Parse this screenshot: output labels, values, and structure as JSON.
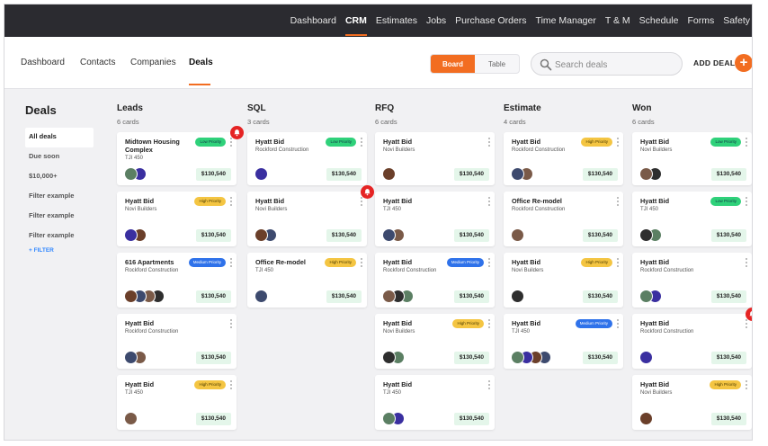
{
  "topnav": [
    "Dashboard",
    "CRM",
    "Estimates",
    "Jobs",
    "Purchase Orders",
    "Time Manager",
    "T & M",
    "Schedule",
    "Forms",
    "Safety"
  ],
  "topnav_active": "CRM",
  "subnav": [
    "Dashboard",
    "Contacts",
    "Companies",
    "Deals"
  ],
  "subnav_active": "Deals",
  "view_toggle": {
    "board": "Board",
    "table": "Table",
    "selected": "Board"
  },
  "search": {
    "placeholder": "Search deals",
    "value": ""
  },
  "add_deal": "ADD DEAL",
  "sidebar": {
    "title": "Deals",
    "items": [
      "All deals",
      "Due soon",
      "$10,000+",
      "Filter example",
      "Filter example",
      "Filter example"
    ],
    "active_index": 0,
    "filter_link": "+ FILTER"
  },
  "priority_labels": {
    "low": "Low Priority",
    "high": "High Priority",
    "medium": "Medium Priority"
  },
  "colors": {
    "accent": "#f26d21",
    "topbar": "#2b2b30",
    "low": "#2fd17a",
    "high": "#f4c542",
    "medium": "#2f72ea",
    "alert": "#e52424",
    "amount_bg": "#e4f6ea",
    "link": "#2f86ff"
  },
  "avatar_colors": [
    "#5b7f63",
    "#3a2fa0",
    "#6b3f2a",
    "#3d4a6e",
    "#7a5a48",
    "#2e2e2e"
  ],
  "columns": [
    {
      "title": "Leads",
      "count": "6 cards",
      "cards": [
        {
          "title": "Midtown Housing Complex",
          "sub": "TJI 450",
          "priority": "low",
          "amount": "$130,540",
          "avatars": 2,
          "alert": true
        },
        {
          "title": "Hyatt Bid",
          "sub": "Novi Builders",
          "priority": "high",
          "amount": "$130,540",
          "avatars": 2
        },
        {
          "title": "616 Apartments",
          "sub": "Rockford Construction",
          "priority": "medium",
          "amount": "$130,540",
          "avatars": 4
        },
        {
          "title": "Hyatt Bid",
          "sub": "Rockford Construction",
          "priority": null,
          "amount": "$130,540",
          "avatars": 2
        },
        {
          "title": "Hyatt Bid",
          "sub": "TJI 450",
          "priority": "high",
          "amount": "$130,540",
          "avatars": 1
        }
      ]
    },
    {
      "title": "SQL",
      "count": "3 cards",
      "cards": [
        {
          "title": "Hyatt Bid",
          "sub": "Rockford Construction",
          "priority": "low",
          "amount": "$130,540",
          "avatars": 1
        },
        {
          "title": "Hyatt Bid",
          "sub": "Novi Builders",
          "priority": null,
          "amount": "$130,540",
          "avatars": 2,
          "alert": true
        },
        {
          "title": "Office Re-model",
          "sub": "TJI 450",
          "priority": "high",
          "amount": "$130,540",
          "avatars": 1
        }
      ]
    },
    {
      "title": "RFQ",
      "count": "6 cards",
      "cards": [
        {
          "title": "Hyatt Bid",
          "sub": "Novi Builders",
          "priority": null,
          "amount": "$130,540",
          "avatars": 1
        },
        {
          "title": "Hyatt Bid",
          "sub": "TJI 450",
          "priority": null,
          "amount": "$130,540",
          "avatars": 2
        },
        {
          "title": "Hyatt Bid",
          "sub": "Rockford Construction",
          "priority": "medium",
          "amount": "$130,540",
          "avatars": 3
        },
        {
          "title": "Hyatt Bid",
          "sub": "Novi Builders",
          "priority": "high",
          "amount": "$130,540",
          "avatars": 2
        },
        {
          "title": "Hyatt Bid",
          "sub": "TJI 450",
          "priority": null,
          "amount": "$130,540",
          "avatars": 2
        }
      ]
    },
    {
      "title": "Estimate",
      "count": "4 cards",
      "cards": [
        {
          "title": "Hyatt Bid",
          "sub": "Rockford Construction",
          "priority": "high",
          "amount": "$130,540",
          "avatars": 2
        },
        {
          "title": "Office Re-model",
          "sub": "Rockford Construction",
          "priority": null,
          "amount": "$130,540",
          "avatars": 1
        },
        {
          "title": "Hyatt Bid",
          "sub": "Novi Builders",
          "priority": "high",
          "amount": "$130,540",
          "avatars": 1
        },
        {
          "title": "Hyatt Bid",
          "sub": "TJI 450",
          "priority": "medium",
          "amount": "$130,540",
          "avatars": 4
        }
      ]
    },
    {
      "title": "Won",
      "count": "6 cards",
      "cards": [
        {
          "title": "Hyatt Bid",
          "sub": "Novi Builders",
          "priority": "low",
          "amount": "$130,540",
          "avatars": 2
        },
        {
          "title": "Hyatt Bid",
          "sub": "TJI 450",
          "priority": "low",
          "amount": "$130,540",
          "avatars": 2
        },
        {
          "title": "Hyatt Bid",
          "sub": "Rockford Construction",
          "priority": null,
          "amount": "$130,540",
          "avatars": 2
        },
        {
          "title": "Hyatt Bid",
          "sub": "Rockford Construction",
          "priority": null,
          "amount": "$130,540",
          "avatars": 1,
          "alert": true
        },
        {
          "title": "Hyatt Bid",
          "sub": "Novi Builders",
          "priority": "high",
          "amount": "$130,540",
          "avatars": 1
        }
      ]
    }
  ]
}
